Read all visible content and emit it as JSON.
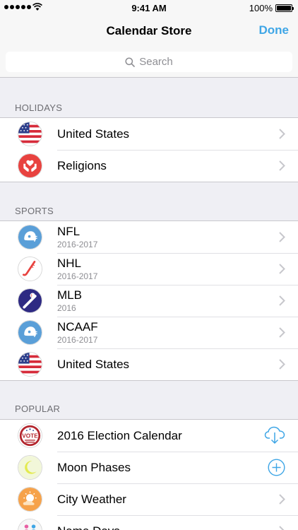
{
  "status": {
    "time": "9:41 AM",
    "battery": "100%"
  },
  "nav": {
    "title": "Calendar Store",
    "done": "Done"
  },
  "search": {
    "placeholder": "Search"
  },
  "sections": {
    "holidays": {
      "header": "HOLIDAYS",
      "items": [
        {
          "label": "United States",
          "icon": "us-flag-icon"
        },
        {
          "label": "Religions",
          "icon": "hands-heart-icon"
        }
      ]
    },
    "sports": {
      "header": "SPORTS",
      "items": [
        {
          "label": "NFL",
          "sub": "2016-2017",
          "icon": "football-helmet-icon"
        },
        {
          "label": "NHL",
          "sub": "2016-2017",
          "icon": "hockey-stick-icon"
        },
        {
          "label": "MLB",
          "sub": "2016",
          "icon": "baseball-bat-icon"
        },
        {
          "label": "NCAAF",
          "sub": "2016-2017",
          "icon": "football-helmet-icon"
        },
        {
          "label": "United States",
          "icon": "us-flag-icon"
        }
      ]
    },
    "popular": {
      "header": "POPULAR",
      "items": [
        {
          "label": "2016 Election Calendar",
          "icon": "vote-icon",
          "action": "cloud-download-icon"
        },
        {
          "label": "Moon Phases",
          "icon": "moon-icon",
          "action": "add-circle-icon"
        },
        {
          "label": "City Weather",
          "icon": "sun-cloud-icon",
          "action": "chevron-right-icon"
        },
        {
          "label": "Name Days",
          "icon": "people-icon",
          "action": "chevron-right-icon"
        }
      ]
    }
  },
  "colors": {
    "accent": "#3fa6e6",
    "background": "#efeff4",
    "separator": "#c8c7cc"
  }
}
